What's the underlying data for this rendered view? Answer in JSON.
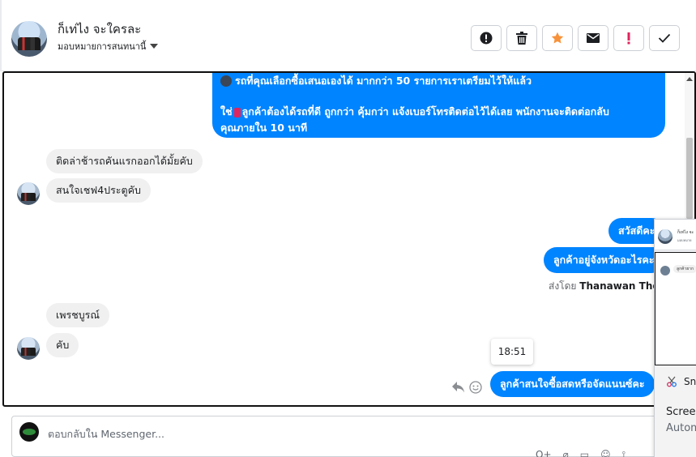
{
  "header": {
    "contact_name": "ก็เท่ไง จะใครละ",
    "assign_label": "มอบหมายการสนทนานี้",
    "actions": [
      {
        "name": "spam-button",
        "icon": "alert-circle-icon"
      },
      {
        "name": "delete-button",
        "icon": "trash-icon"
      },
      {
        "name": "star-button",
        "icon": "star-icon",
        "color": "#f7923b"
      },
      {
        "name": "mark-unread-button",
        "icon": "envelope-icon"
      },
      {
        "name": "follow-up-button",
        "icon": "exclamation-icon",
        "color": "#e0245e"
      },
      {
        "name": "mark-done-button",
        "icon": "check-icon"
      }
    ]
  },
  "messages": {
    "big_out_line1": "รถที่คุณเลือกซื้อเสนอเองได้ มากกว่า 50 รายการเราเตรียมไว้ให้แล้ว",
    "big_out_line2a": "ใช่",
    "big_out_line2b": "ลูกค้าต้องได้รถที่ดี ถูกกว่า คุ้มกว่า แจ้งเบอร์โทรติดต่อไว้ได้เลย พนักงานจะติดต่อกลับ",
    "big_out_line3": "คุณภายใน 10 นาที",
    "in1": "ติดล่าช้ารถคันแรกออกได้มั้ยคับ",
    "in2": "สนใจเชฟ4ประตูคับ",
    "out1": "สวัสดีคะ",
    "out2": "ลูกค้าอยู่จังหวัดอะไรคะ",
    "sent_by_prefix": "ส่งโดย",
    "sent_by_name": "Thanawan Thon",
    "in3": "เพรชบูรณ์",
    "in4": "คับ",
    "time": "18:51",
    "out3": "ลูกค้าสนใจซื้อสดหรือจัดแนนซ์คะ"
  },
  "composer": {
    "placeholder": "ตอบกลับใน Messenger...",
    "tools": [
      "Q+",
      "⌀",
      "▭",
      "☺",
      "⟟"
    ]
  },
  "overlay": {
    "name": "ก็เท่ไง จะ",
    "sub": "มอบหมาย",
    "msg": "ลูกค้ายาก",
    "snip": "Sn",
    "screen": "Screen",
    "auto": "Autom"
  }
}
